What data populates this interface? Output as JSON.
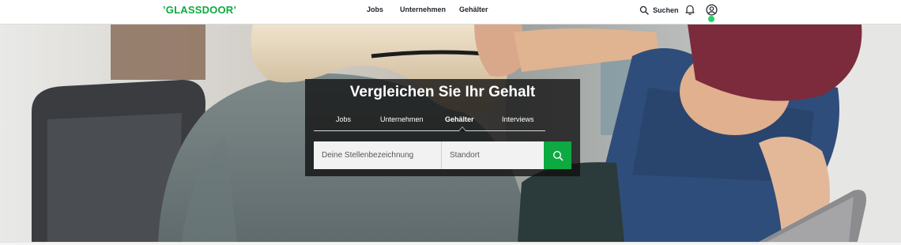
{
  "brand": {
    "logo_text": "’GLASSDOOR’",
    "accent": "#0caa41"
  },
  "nav": {
    "links": [
      "Jobs",
      "Unternehmen",
      "Gehälter"
    ],
    "search_label": "Suchen",
    "icons": [
      "search-icon",
      "bell-icon",
      "profile-icon"
    ],
    "status_dot_color": "#25d366"
  },
  "hero": {
    "title": "Vergleichen Sie Ihr Gehalt",
    "tabs": [
      "Jobs",
      "Unternehmen",
      "Gehälter",
      "Interviews"
    ],
    "active_tab": "Gehälter",
    "job_placeholder": "Deine Stellenbezeichnung",
    "location_placeholder": "Standort",
    "search_button_icon": "search-icon"
  }
}
